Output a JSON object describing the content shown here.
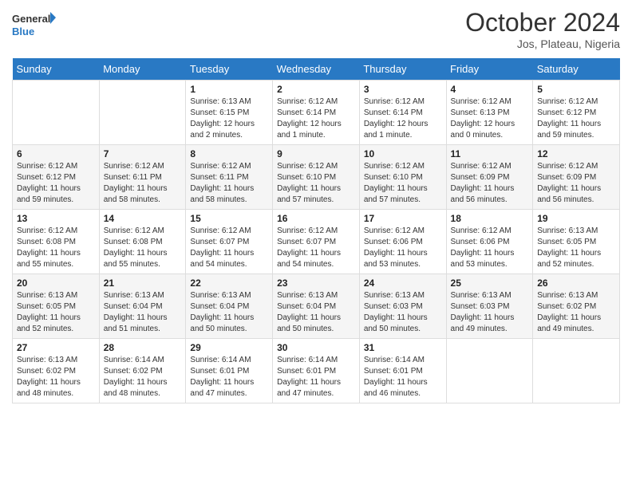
{
  "header": {
    "logo_line1": "General",
    "logo_line2": "Blue",
    "month_year": "October 2024",
    "location": "Jos, Plateau, Nigeria"
  },
  "days_of_week": [
    "Sunday",
    "Monday",
    "Tuesday",
    "Wednesday",
    "Thursday",
    "Friday",
    "Saturday"
  ],
  "weeks": [
    [
      {
        "day": "",
        "info": ""
      },
      {
        "day": "",
        "info": ""
      },
      {
        "day": "1",
        "info": "Sunrise: 6:13 AM\nSunset: 6:15 PM\nDaylight: 12 hours and 2 minutes."
      },
      {
        "day": "2",
        "info": "Sunrise: 6:12 AM\nSunset: 6:14 PM\nDaylight: 12 hours and 1 minute."
      },
      {
        "day": "3",
        "info": "Sunrise: 6:12 AM\nSunset: 6:14 PM\nDaylight: 12 hours and 1 minute."
      },
      {
        "day": "4",
        "info": "Sunrise: 6:12 AM\nSunset: 6:13 PM\nDaylight: 12 hours and 0 minutes."
      },
      {
        "day": "5",
        "info": "Sunrise: 6:12 AM\nSunset: 6:12 PM\nDaylight: 11 hours and 59 minutes."
      }
    ],
    [
      {
        "day": "6",
        "info": "Sunrise: 6:12 AM\nSunset: 6:12 PM\nDaylight: 11 hours and 59 minutes."
      },
      {
        "day": "7",
        "info": "Sunrise: 6:12 AM\nSunset: 6:11 PM\nDaylight: 11 hours and 58 minutes."
      },
      {
        "day": "8",
        "info": "Sunrise: 6:12 AM\nSunset: 6:11 PM\nDaylight: 11 hours and 58 minutes."
      },
      {
        "day": "9",
        "info": "Sunrise: 6:12 AM\nSunset: 6:10 PM\nDaylight: 11 hours and 57 minutes."
      },
      {
        "day": "10",
        "info": "Sunrise: 6:12 AM\nSunset: 6:10 PM\nDaylight: 11 hours and 57 minutes."
      },
      {
        "day": "11",
        "info": "Sunrise: 6:12 AM\nSunset: 6:09 PM\nDaylight: 11 hours and 56 minutes."
      },
      {
        "day": "12",
        "info": "Sunrise: 6:12 AM\nSunset: 6:09 PM\nDaylight: 11 hours and 56 minutes."
      }
    ],
    [
      {
        "day": "13",
        "info": "Sunrise: 6:12 AM\nSunset: 6:08 PM\nDaylight: 11 hours and 55 minutes."
      },
      {
        "day": "14",
        "info": "Sunrise: 6:12 AM\nSunset: 6:08 PM\nDaylight: 11 hours and 55 minutes."
      },
      {
        "day": "15",
        "info": "Sunrise: 6:12 AM\nSunset: 6:07 PM\nDaylight: 11 hours and 54 minutes."
      },
      {
        "day": "16",
        "info": "Sunrise: 6:12 AM\nSunset: 6:07 PM\nDaylight: 11 hours and 54 minutes."
      },
      {
        "day": "17",
        "info": "Sunrise: 6:12 AM\nSunset: 6:06 PM\nDaylight: 11 hours and 53 minutes."
      },
      {
        "day": "18",
        "info": "Sunrise: 6:12 AM\nSunset: 6:06 PM\nDaylight: 11 hours and 53 minutes."
      },
      {
        "day": "19",
        "info": "Sunrise: 6:13 AM\nSunset: 6:05 PM\nDaylight: 11 hours and 52 minutes."
      }
    ],
    [
      {
        "day": "20",
        "info": "Sunrise: 6:13 AM\nSunset: 6:05 PM\nDaylight: 11 hours and 52 minutes."
      },
      {
        "day": "21",
        "info": "Sunrise: 6:13 AM\nSunset: 6:04 PM\nDaylight: 11 hours and 51 minutes."
      },
      {
        "day": "22",
        "info": "Sunrise: 6:13 AM\nSunset: 6:04 PM\nDaylight: 11 hours and 50 minutes."
      },
      {
        "day": "23",
        "info": "Sunrise: 6:13 AM\nSunset: 6:04 PM\nDaylight: 11 hours and 50 minutes."
      },
      {
        "day": "24",
        "info": "Sunrise: 6:13 AM\nSunset: 6:03 PM\nDaylight: 11 hours and 50 minutes."
      },
      {
        "day": "25",
        "info": "Sunrise: 6:13 AM\nSunset: 6:03 PM\nDaylight: 11 hours and 49 minutes."
      },
      {
        "day": "26",
        "info": "Sunrise: 6:13 AM\nSunset: 6:02 PM\nDaylight: 11 hours and 49 minutes."
      }
    ],
    [
      {
        "day": "27",
        "info": "Sunrise: 6:13 AM\nSunset: 6:02 PM\nDaylight: 11 hours and 48 minutes."
      },
      {
        "day": "28",
        "info": "Sunrise: 6:14 AM\nSunset: 6:02 PM\nDaylight: 11 hours and 48 minutes."
      },
      {
        "day": "29",
        "info": "Sunrise: 6:14 AM\nSunset: 6:01 PM\nDaylight: 11 hours and 47 minutes."
      },
      {
        "day": "30",
        "info": "Sunrise: 6:14 AM\nSunset: 6:01 PM\nDaylight: 11 hours and 47 minutes."
      },
      {
        "day": "31",
        "info": "Sunrise: 6:14 AM\nSunset: 6:01 PM\nDaylight: 11 hours and 46 minutes."
      },
      {
        "day": "",
        "info": ""
      },
      {
        "day": "",
        "info": ""
      }
    ]
  ]
}
